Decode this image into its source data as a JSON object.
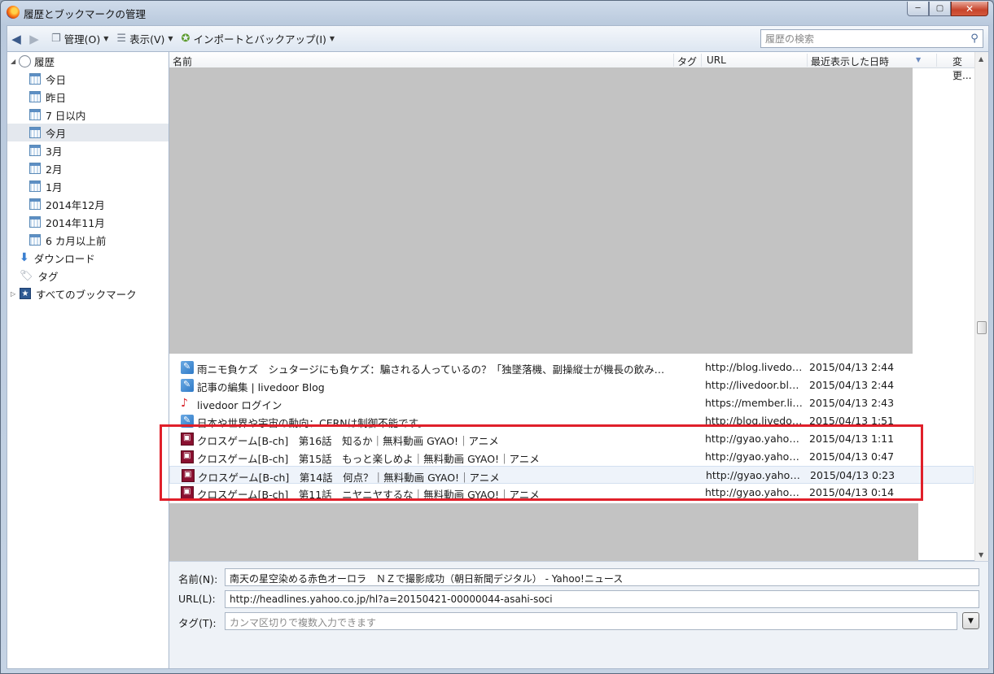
{
  "window": {
    "title": "履歴とブックマークの管理",
    "minimize": "─",
    "maximize": "▢",
    "close": "✕"
  },
  "toolbar": {
    "back": "◀",
    "forward": "▶",
    "organize_label": "管理(O)",
    "views_label": "表示(V)",
    "import_label": "インポートとバックアップ(I)",
    "search_placeholder": "履歴の検索",
    "search_icon": "⚲"
  },
  "sidebar": {
    "history": "履歴",
    "items": [
      "今日",
      "昨日",
      "7 日以内",
      "今月",
      "3月",
      "2月",
      "1月",
      "2014年12月",
      "2014年11月",
      "6 カ月以上前"
    ],
    "selected_index": 3,
    "downloads": "ダウンロード",
    "tags": "タグ",
    "all_bookmarks": "すべてのブックマーク"
  },
  "list": {
    "columns": {
      "name": "名前",
      "tags": "タグ",
      "url": "URL",
      "date": "最近表示した日時",
      "changed": "変更..."
    },
    "rows": [
      {
        "icon": "livedoor-icon",
        "name": "雨ニモ負ケズ　シュタージにも負ケズ：騙される人っているの？「独墜落機、副操縦士が機長の飲み物に...",
        "url": "http://blog.livedoo....",
        "date": "2015/04/13 2:44"
      },
      {
        "icon": "livedoor-icon",
        "name": "記事の編集 | livedoor Blog",
        "url": "http://livedoor.blo....",
        "date": "2015/04/13 2:44"
      },
      {
        "icon": "ps-icon",
        "name": "livedoor ログイン",
        "url": "https://member.liv....",
        "date": "2015/04/13 2:43"
      },
      {
        "icon": "livedoor-icon",
        "name": "日本や世界や宇宙の動向：CERNは制御不能です。",
        "url": "http://blog.livedoo....",
        "date": "2015/04/13 1:51"
      },
      {
        "icon": "gyao-icon",
        "name": "クロスゲーム[B-ch]　第16話　知るか｜無料動画 GYAO!｜アニメ",
        "url": "http://gyao.yahoo....",
        "date": "2015/04/13 1:11"
      },
      {
        "icon": "gyao-icon",
        "name": "クロスゲーム[B-ch]　第15話　もっと楽しめよ｜無料動画 GYAO!｜アニメ",
        "url": "http://gyao.yahoo....",
        "date": "2015/04/13 0:47"
      },
      {
        "icon": "gyao-icon",
        "name": "クロスゲーム[B-ch]　第14話　何点？｜無料動画 GYAO!｜アニメ",
        "url": "http://gyao.yahoo....",
        "date": "2015/04/13 0:23"
      },
      {
        "icon": "gyao-icon",
        "name": "クロスゲーム[B-ch]　第11話　ニヤニヤするな｜無料動画 GYAO!｜アニメ",
        "url": "http://gyao.yahoo....",
        "date": "2015/04/13 0:14"
      }
    ],
    "hover_index": 6
  },
  "details": {
    "name_label": "名前(N):",
    "name_value": "南天の星空染める赤色オーロラ　ＮＺで撮影成功（朝日新聞デジタル） - Yahoo!ニュース",
    "url_label": "URL(L):",
    "url_value": "http://headlines.yahoo.co.jp/hl?a=20150421-00000044-asahi-soci",
    "tags_label": "タグ(T):",
    "tags_placeholder": "カンマ区切りで複数入力できます"
  },
  "colors": {
    "highlight_box": "#e0202a",
    "redaction": "#c3c3c3"
  }
}
